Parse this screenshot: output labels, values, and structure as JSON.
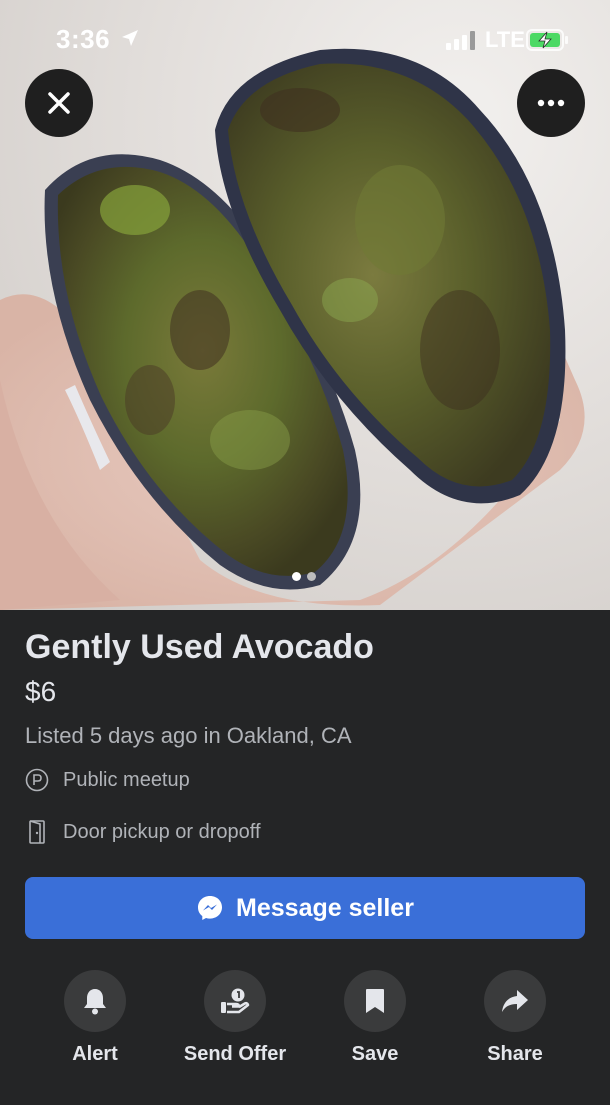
{
  "status_bar": {
    "time": "3:36",
    "network": "LTE"
  },
  "photo": {
    "description_icon": "avocado-photo",
    "page_count": 2,
    "current_page": 1
  },
  "listing": {
    "title": "Gently Used Avocado",
    "price": "$6",
    "listed": "Listed 5 days ago in Oakland, CA",
    "meetup": "Public meetup",
    "pickup": "Door pickup or dropoff"
  },
  "buttons": {
    "message": "Message seller",
    "alert": "Alert",
    "send_offer": "Send Offer",
    "save": "Save",
    "share": "Share"
  },
  "colors": {
    "background": "#242526",
    "primary": "#3a6fd8",
    "action_circle": "#3a3b3c"
  }
}
